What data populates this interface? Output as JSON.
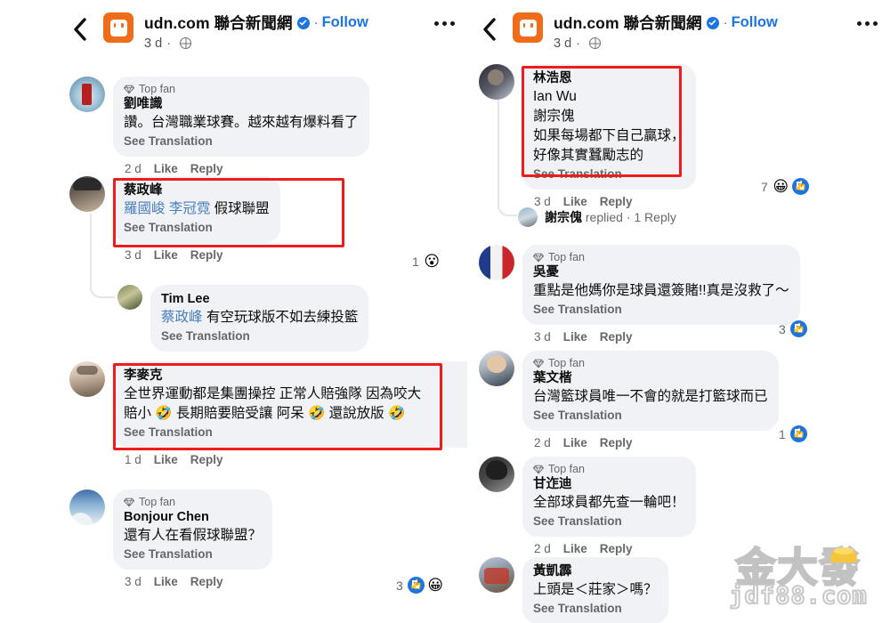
{
  "post_header": {
    "back_label": "‹",
    "page_name": "udn.com 聯合新聞網",
    "separator": "·",
    "follow_label": "Follow",
    "time_ago": "3 d",
    "meta_dot": "·"
  },
  "labels": {
    "top_fan": "Top fan",
    "see_translation": "See Translation",
    "like": "Like",
    "reply": "Reply",
    "replied_suffix": "replied",
    "reply_count": "1 Reply",
    "meta_dot": "·"
  },
  "left_panel": {
    "comments": [
      {
        "avatar": "av1",
        "top_fan": true,
        "name": "劉唯識",
        "text_parts": [
          {
            "type": "text",
            "value": "讚。台灣職業球賽。越來越有爆料看了"
          }
        ],
        "see_translation": "See Translation",
        "time": "2 d",
        "like": "Like",
        "reply": "Reply",
        "highlighted": false,
        "reactions": null
      },
      {
        "avatar": "av2",
        "top_fan": false,
        "name": "蔡政峰",
        "text_parts": [
          {
            "type": "mention",
            "value": "羅國峻"
          },
          {
            "type": "mention",
            "value": "李冠霓"
          },
          {
            "type": "text",
            "value": "假球聯盟"
          }
        ],
        "see_translation": "See Translation",
        "time": "3 d",
        "like": "Like",
        "reply": "Reply",
        "highlighted": true,
        "reactions": {
          "count": "1",
          "icons": [
            "wow-emoji"
          ]
        }
      },
      {
        "avatar": "av3",
        "top_fan": false,
        "name": "Tim Lee",
        "is_reply": true,
        "text_parts": [
          {
            "type": "mention",
            "value": "蔡政峰"
          },
          {
            "type": "text",
            "value": "有空玩球版不如去練投籃"
          }
        ],
        "see_translation": "See Translation",
        "time": "",
        "like": "",
        "reply": "",
        "highlighted": false,
        "reactions": null
      },
      {
        "avatar": "av4",
        "top_fan": false,
        "name": "李麥克",
        "text_lines": [
          "全世界運動都是集團操控 正常人賠強隊 因為咬大",
          "賠小 🤣 長期賠要賠受讓 阿呆 🤣 還說放版 🤣"
        ],
        "see_translation": "See Translation",
        "time": "1 d",
        "like": "Like",
        "reply": "Reply",
        "highlighted": true,
        "reactions": null
      },
      {
        "avatar": "av5",
        "top_fan": true,
        "name": "Bonjour Chen",
        "text_parts": [
          {
            "type": "text",
            "value": "還有人在看假球聯盟？"
          }
        ],
        "see_translation": "See Translation",
        "time": "3 d",
        "like": "Like",
        "reply": "Reply",
        "highlighted": false,
        "reactions": {
          "count": "3",
          "icons": [
            "like-thumb",
            "haha-emoji"
          ]
        }
      }
    ]
  },
  "right_panel": {
    "comments": [
      {
        "avatar": "av6",
        "top_fan": false,
        "name": "林浩恩",
        "mentions": [
          "Ian Wu",
          "謝宗傀"
        ],
        "text_lines": [
          "如果每場都下自己贏球，",
          "好像其實蠶勵志的"
        ],
        "see_translation": "See Translation",
        "time": "3 d",
        "like": "Like",
        "reply": "Reply",
        "highlighted": true,
        "reactions": {
          "count": "7",
          "icons": [
            "haha-emoji",
            "like-thumb"
          ]
        }
      },
      {
        "replied_row": true,
        "avatar": "av11",
        "name": "謝宗傀",
        "replied_suffix": "replied",
        "dot": "·",
        "reply_count": "1 Reply"
      },
      {
        "avatar": "av-fr",
        "top_fan": true,
        "name": "吳憂",
        "text_parts": [
          {
            "type": "text",
            "value": "重點是他媽你是球員還簽賭!!真是沒救了～"
          }
        ],
        "see_translation": "See Translation",
        "time": "3 d",
        "like": "Like",
        "reply": "Reply",
        "highlighted": false,
        "reactions": {
          "count": "3",
          "icons": [
            "like-thumb"
          ]
        }
      },
      {
        "avatar": "av7",
        "top_fan": true,
        "name": "葉文楷",
        "text_parts": [
          {
            "type": "text",
            "value": "台灣籃球員唯一不會的就是打籃球而已"
          }
        ],
        "see_translation": "See Translation",
        "time": "2 d",
        "like": "Like",
        "reply": "Reply",
        "highlighted": false,
        "reactions": {
          "count": "1",
          "icons": [
            "like-thumb"
          ]
        }
      },
      {
        "avatar": "av8",
        "top_fan": true,
        "name": "甘迮迪",
        "text_parts": [
          {
            "type": "text",
            "value": "全部球員都先查一輪吧！"
          }
        ],
        "see_translation": "See Translation",
        "time": "2 d",
        "like": "Like",
        "reply": "Reply",
        "highlighted": false,
        "reactions": null
      },
      {
        "avatar": "av9",
        "top_fan": false,
        "name": "黃凱霹",
        "text_parts": [
          {
            "type": "text",
            "value": "上頭是＜莊家＞嗎？"
          }
        ],
        "see_translation": "See Translation",
        "time": "",
        "like": "",
        "reply": "",
        "highlighted": false,
        "reactions": null
      }
    ]
  },
  "watermark": {
    "cn_text": "金大發",
    "domain": "jdf88.com"
  },
  "colors": {
    "accent_blue": "#1b74e4",
    "mention_blue": "#4a7fbf",
    "highlight_red": "#ee1c1c",
    "bubble_gray": "#f0f2f5",
    "muted_text": "#65676b",
    "brand_orange": "#ef6c1b"
  }
}
